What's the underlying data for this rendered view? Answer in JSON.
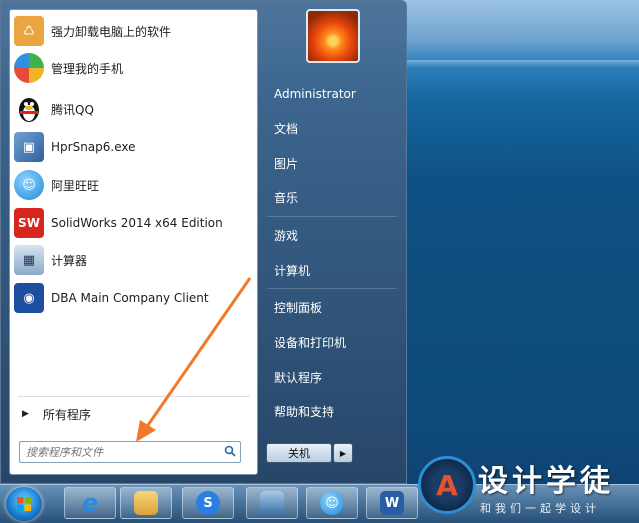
{
  "start_menu": {
    "programs": [
      {
        "label": "强力卸载电脑上的软件",
        "icon": "uninstaller-icon",
        "color": "#e8a23a"
      },
      {
        "label": "管理我的手机",
        "icon": "phone-manager-icon",
        "color": "#3fb24b"
      },
      {
        "label": "腾讯QQ",
        "icon": "qq-penguin-icon",
        "color": "#111111"
      },
      {
        "label": "HprSnap6.exe",
        "icon": "hypersnap-icon",
        "color": "#3f6fa8"
      },
      {
        "label": "阿里旺旺",
        "icon": "aliwangwang-icon",
        "color": "#2a9ae0"
      },
      {
        "label": "SolidWorks 2014 x64 Edition",
        "icon": "solidworks-icon",
        "color": "#d8261f"
      },
      {
        "label": "计算器",
        "icon": "calculator-icon",
        "color": "#6a8fb6"
      },
      {
        "label": "DBA Main Company Client",
        "icon": "dba-client-icon",
        "color": "#1c4fa0"
      }
    ],
    "all_programs_label": "所有程序",
    "search_placeholder": "搜索程序和文件",
    "right_items": [
      {
        "label": "Administrator"
      },
      {
        "label": "文档"
      },
      {
        "label": "图片"
      },
      {
        "label": "音乐"
      },
      {
        "label": "游戏"
      },
      {
        "label": "计算机"
      },
      {
        "label": "控制面板"
      },
      {
        "label": "设备和打印机"
      },
      {
        "label": "默认程序"
      },
      {
        "label": "帮助和支持"
      }
    ],
    "shutdown_label": "关机"
  },
  "taskbar": {
    "buttons": [
      {
        "icon": "internet-explorer-icon",
        "color": "#2a7fd4"
      },
      {
        "icon": "file-explorer-icon",
        "color": "#e2b548"
      },
      {
        "icon": "sogou-input-icon",
        "color": "#2b7fe0"
      },
      {
        "icon": "image-viewer-icon",
        "color": "#4a84b8"
      },
      {
        "icon": "aliwangwang-icon",
        "color": "#2a9ae0"
      },
      {
        "icon": "word-icon",
        "color": "#2a5ca8"
      }
    ]
  },
  "watermark": {
    "title": "设计学徒",
    "subtitle": "和我们一起学设计",
    "logo_letter": "A"
  },
  "colors": {
    "annotation_arrow": "#f07a2a"
  }
}
